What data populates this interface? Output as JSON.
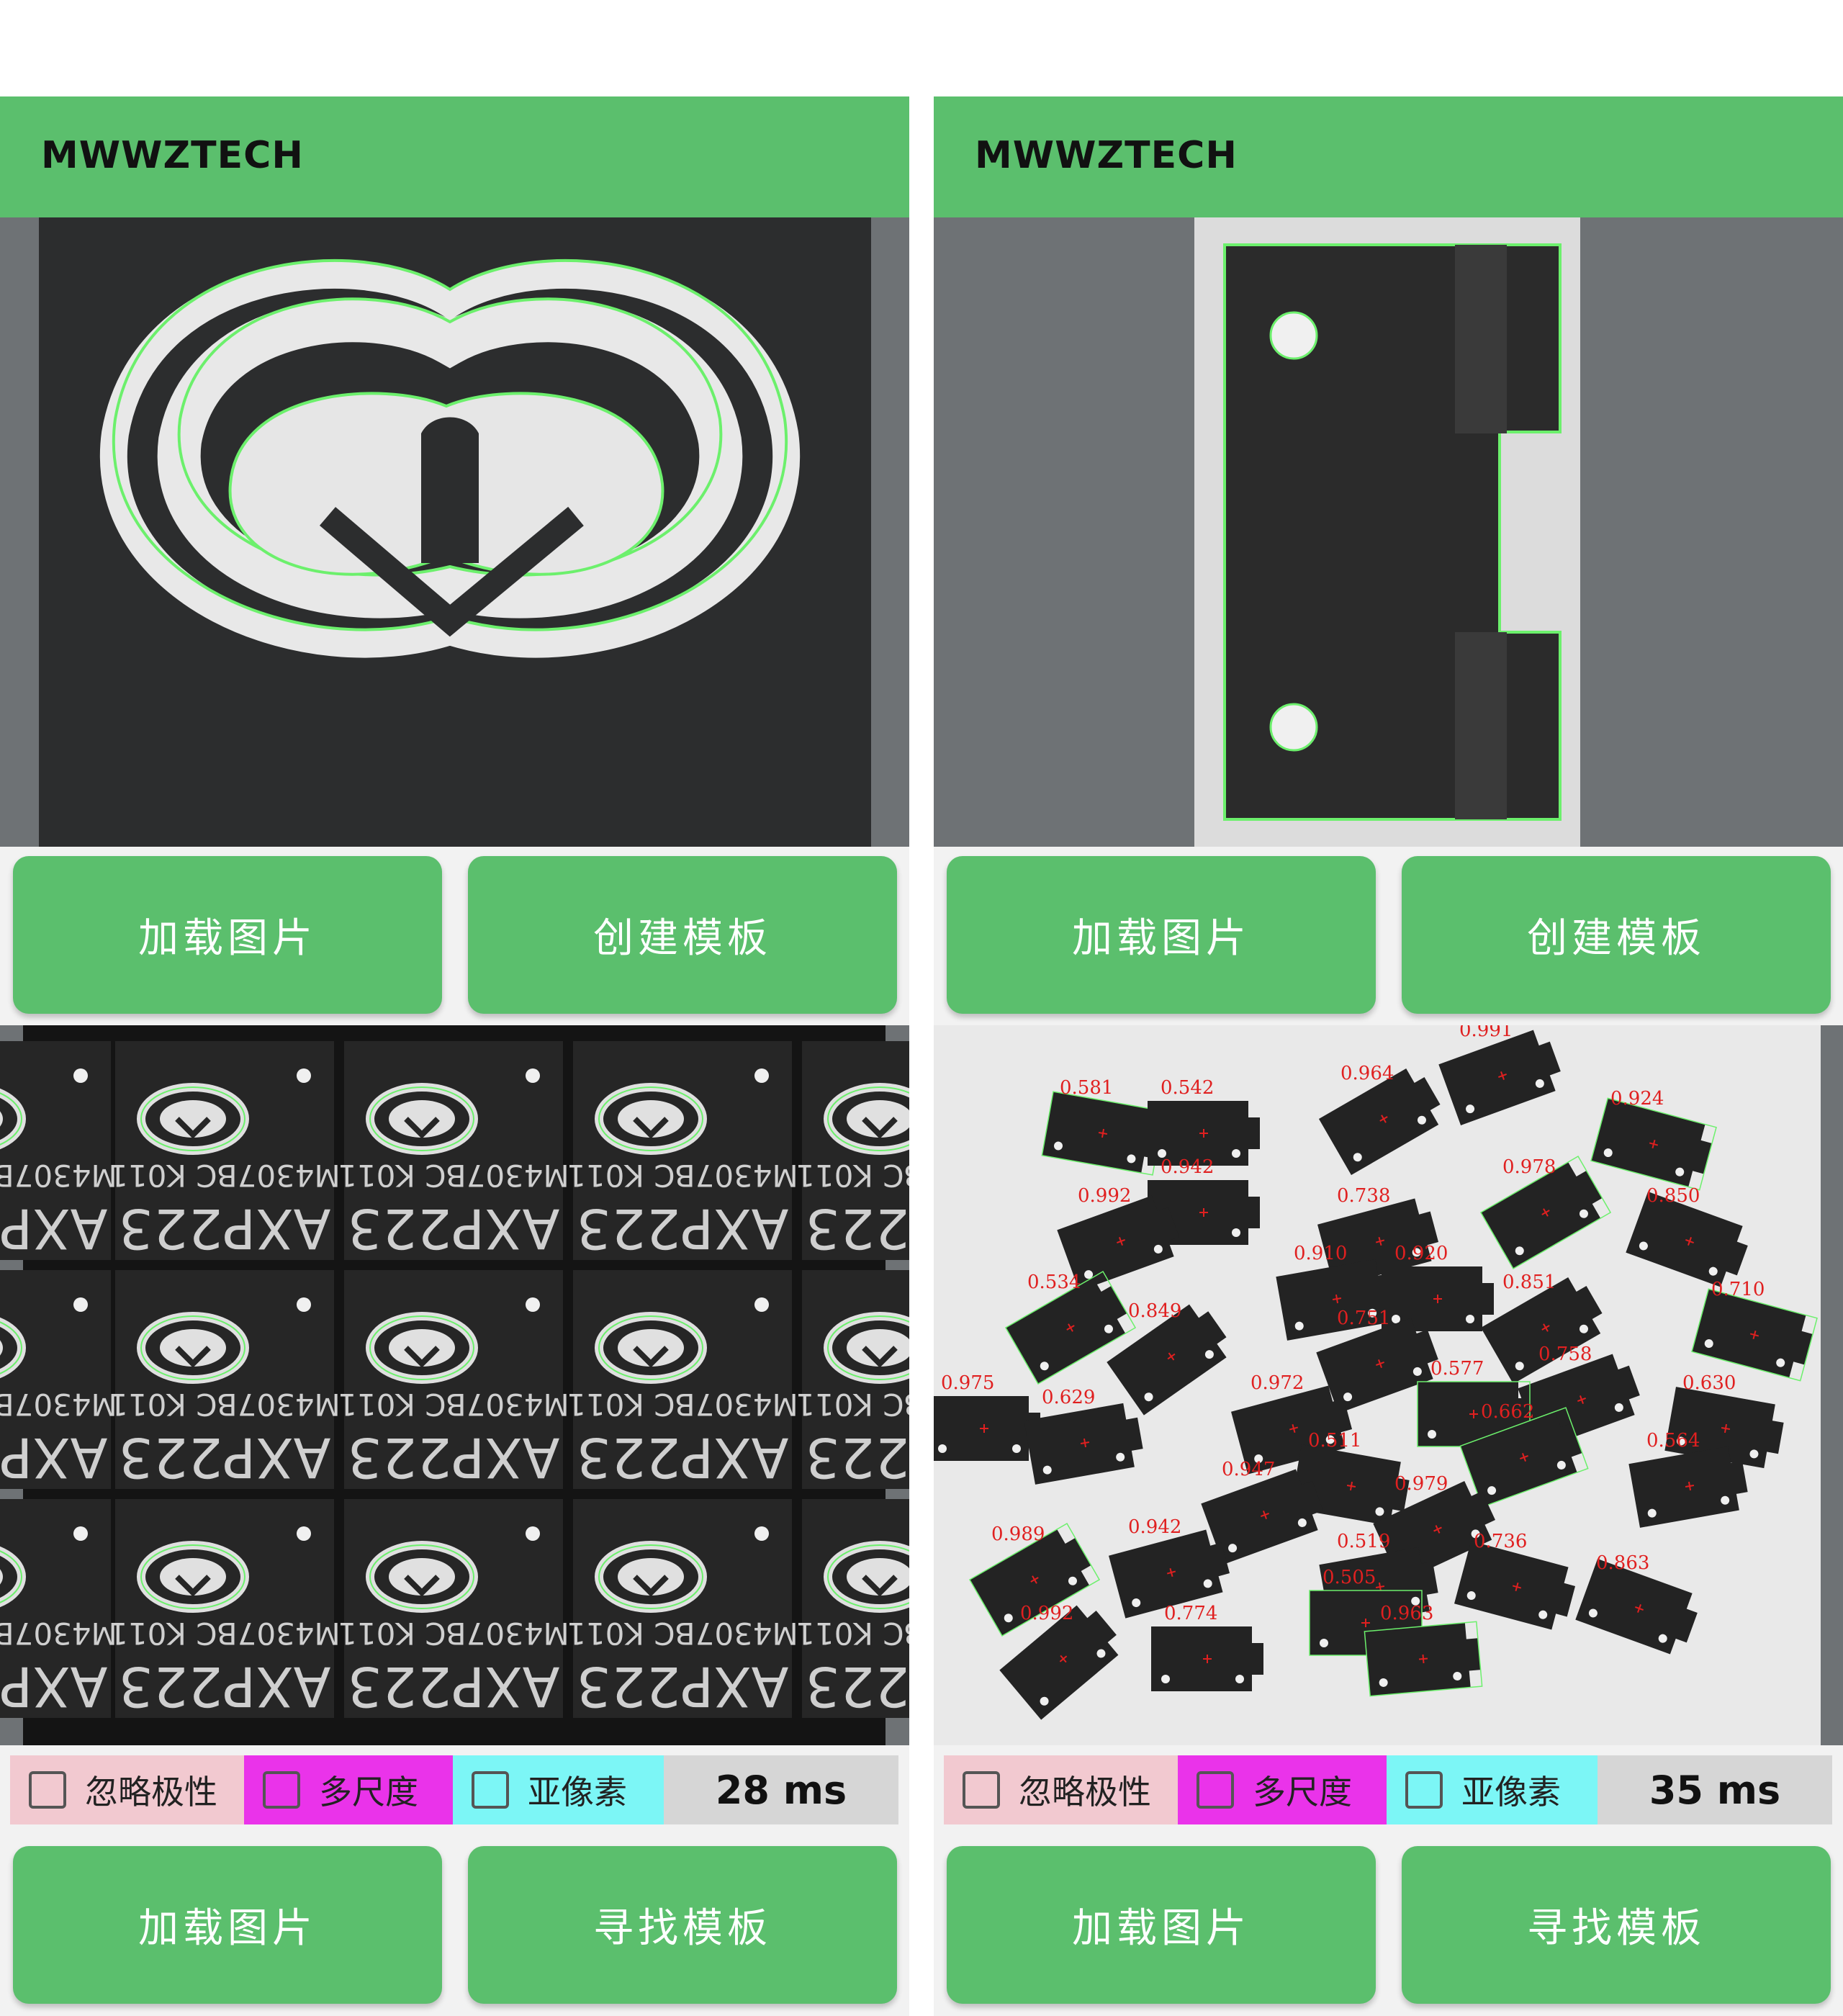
{
  "panels": [
    {
      "title": "MWWZTECH",
      "buttons": {
        "load_top": "加载图片",
        "create": "创建模板",
        "load_bottom": "加载图片",
        "find": "寻找模板"
      },
      "options": {
        "ignore_polarity": "忽略极性",
        "multi_scale": "多尺度",
        "subpixel": "亚像素"
      },
      "time": "28 ms",
      "chip_texts": {
        "line1": "M4307BC K011",
        "line2": "AXP223"
      }
    },
    {
      "title": "MWWZTECH",
      "buttons": {
        "load_top": "加载图片",
        "create": "创建模板",
        "load_bottom": "加载图片",
        "find": "寻找模板"
      },
      "options": {
        "ignore_polarity": "忽略极性",
        "multi_scale": "多尺度",
        "subpixel": "亚像素"
      },
      "time": "35 ms",
      "scores": [
        "0.581",
        "0.542",
        "0.964",
        "0.991",
        "0.924",
        "0.942",
        "0.992",
        "0.738",
        "0.978",
        "0.850",
        "0.910",
        "0.920",
        "0.534",
        "0.849",
        "0.751",
        "0.851",
        "0.710",
        "0.630",
        "0.758",
        "0.972",
        "0.577",
        "0.511",
        "0.975",
        "0.629",
        "0.662",
        "0.564",
        "0.979",
        "0.947",
        "0.989",
        "0.942",
        "0.519",
        "0.736",
        "0.505",
        "0.863",
        "0.992",
        "0.774",
        "0.963"
      ]
    }
  ],
  "colors": {
    "accent": "#5bbf6d",
    "polarity_bg": "#f2c9d0",
    "multiscale_bg": "#ea33ea",
    "subpixel_bg": "#7cf6f6",
    "score_text": "#e02020",
    "contour": "#6cf06c"
  }
}
